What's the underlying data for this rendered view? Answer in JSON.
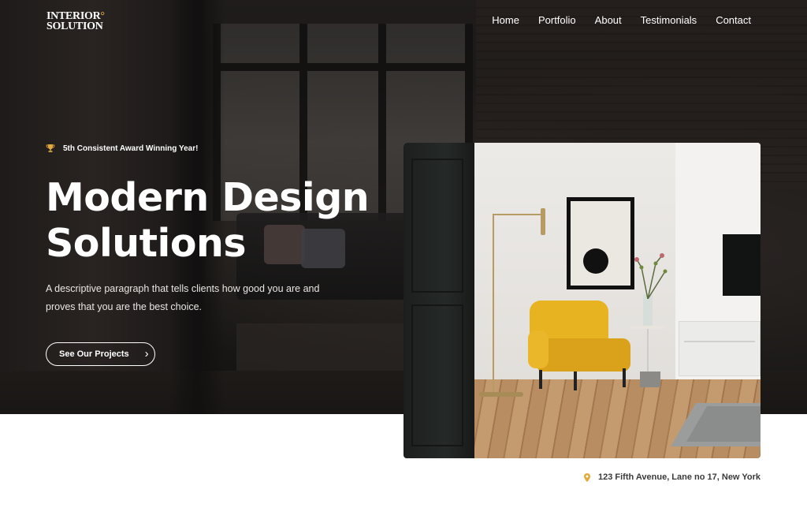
{
  "brand": {
    "line1": "INTERIOR",
    "line1_dot": "°",
    "line2": "SOLUTION"
  },
  "nav": {
    "items": [
      "Home",
      "Portfolio",
      "About",
      "Testimonials",
      "Contact"
    ]
  },
  "hero": {
    "award_icon": "trophy-icon",
    "award_text": "5th Consistent Award Winning Year!",
    "headline_line1": "Modern Design",
    "headline_line2": "Solutions",
    "description": "A descriptive paragraph that tells clients how good you are and proves that you are the best choice.",
    "cta_label": "See Our Projects",
    "cta_icon": "chevron-right-icon"
  },
  "address": {
    "icon": "location-pin-icon",
    "text": "123 Fifth Avenue, Lane no 17, New York"
  },
  "colors": {
    "accent": "#e2a93b",
    "hero_bg": "#1f1c1b",
    "text_on_dark": "#ffffff",
    "address_text": "#3a3a3a",
    "chair_yellow": "#e8b321"
  }
}
